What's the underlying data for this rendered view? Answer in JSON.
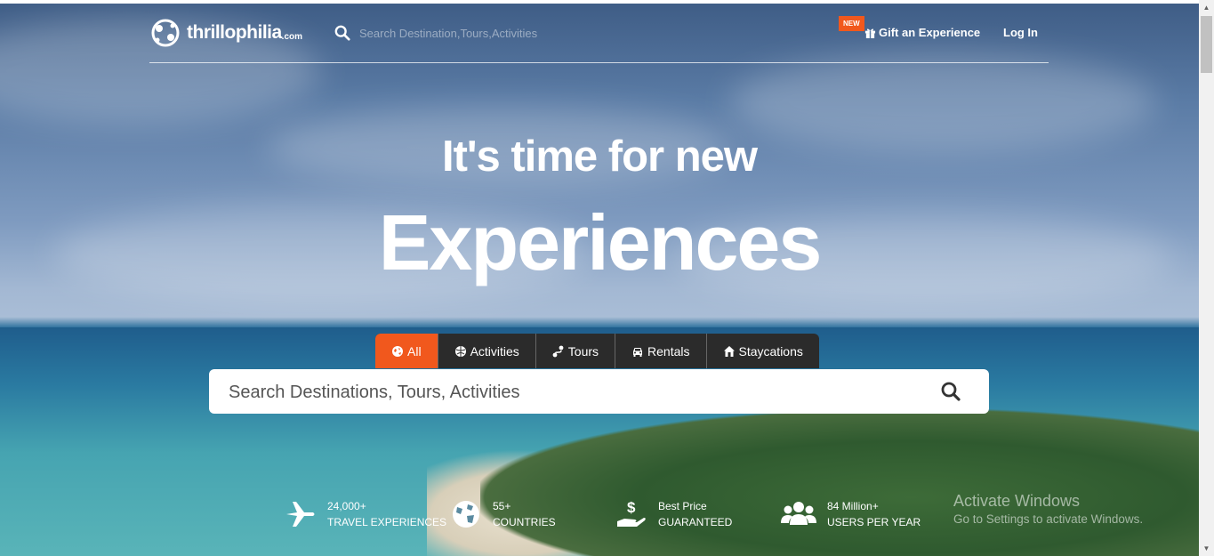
{
  "header": {
    "logo_text": "thrillophilia",
    "logo_suffix": ".com",
    "search_placeholder": "Search Destination,Tours,Activities",
    "new_badge": "NEW",
    "gift_label": "Gift an Experience",
    "login_label": "Log In"
  },
  "hero": {
    "headline": "It's time for new",
    "headline_big": "Experiences"
  },
  "tabs": [
    {
      "label": "All",
      "icon": "globe-icon",
      "active": true
    },
    {
      "label": "Activities",
      "icon": "ball-icon",
      "active": false
    },
    {
      "label": "Tours",
      "icon": "route-icon",
      "active": false
    },
    {
      "label": "Rentals",
      "icon": "car-icon",
      "active": false
    },
    {
      "label": "Staycations",
      "icon": "home-icon",
      "active": false
    }
  ],
  "main_search": {
    "placeholder": "Search Destinations, Tours, Activities"
  },
  "stats": [
    {
      "top": "24,000+",
      "bottom": "TRAVEL EXPERIENCES",
      "icon": "plane-icon"
    },
    {
      "top": "55+",
      "bottom": "COUNTRIES",
      "icon": "globe-icon"
    },
    {
      "top": "Best Price",
      "bottom": "GUARANTEED",
      "icon": "price-hand-icon"
    },
    {
      "top": "84 Million+",
      "bottom": "USERS PER YEAR",
      "icon": "users-icon"
    }
  ],
  "watermark": {
    "title": "Activate Windows",
    "subtitle": "Go to Settings to activate Windows."
  },
  "colors": {
    "accent": "#f1581d",
    "tab_bg": "#2b2b2b"
  }
}
